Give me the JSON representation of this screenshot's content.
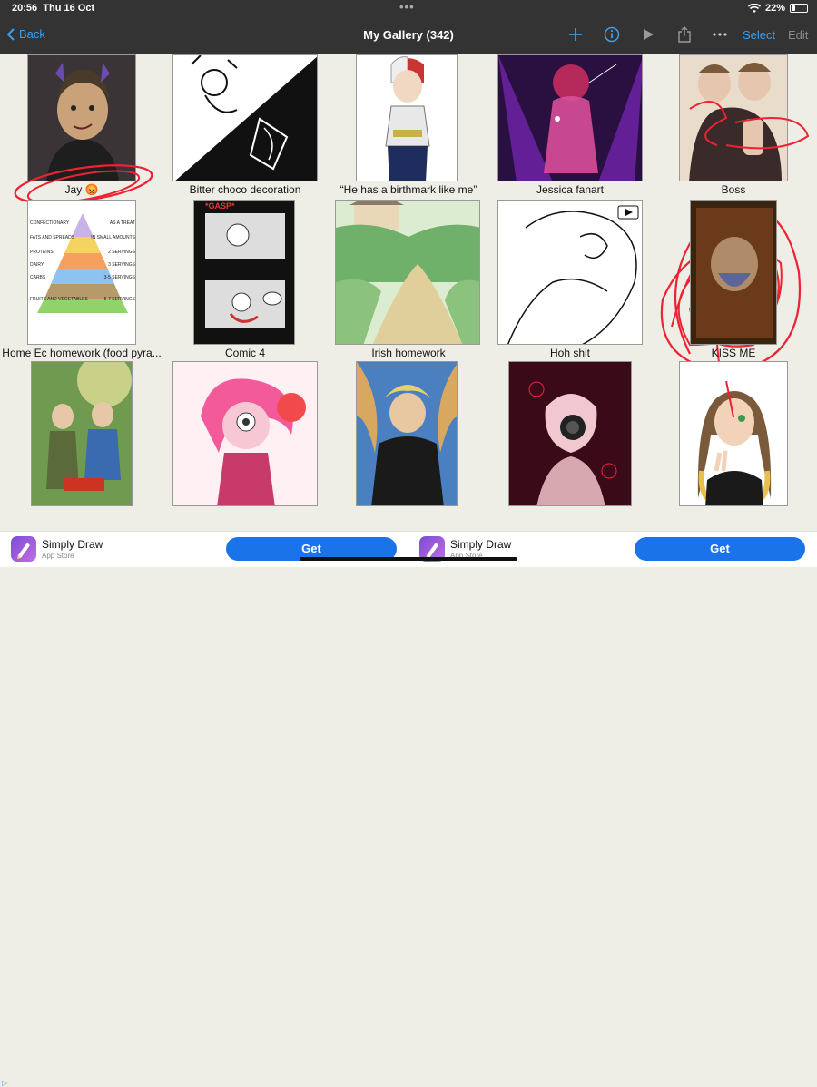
{
  "status": {
    "time": "20:56",
    "date": "Thu 16 Oct",
    "battery": "22%",
    "battery_level": 0.22
  },
  "nav": {
    "back_label": "Back",
    "title": "My Gallery (342)",
    "select_label": "Select",
    "edit_label": "Edit"
  },
  "gallery": {
    "items": [
      {
        "caption": "Jay 😡"
      },
      {
        "caption": "Bitter choco decoration"
      },
      {
        "caption": "“He has a birthmark like me”"
      },
      {
        "caption": "Jessica fanart"
      },
      {
        "caption": "Boss"
      },
      {
        "caption": "Home Ec homework (food pyra..."
      },
      {
        "caption": "Comic 4"
      },
      {
        "caption": "Irish homework"
      },
      {
        "caption": "Hoh shit"
      },
      {
        "caption": "KISS ME"
      }
    ],
    "pyramid_text": {
      "l1": "CONFECTIONARY",
      "l1b": "AS A TREAT",
      "l2": "FATS AND SPREADS",
      "l2b": "IN SMALL AMOUNTS",
      "l3": "PROTEINS",
      "l3b": "2 SERVINGS",
      "l4": "DAIRY",
      "l4b": "3 SERVINGS",
      "l5": "CARBS",
      "l5b": "3-5 SERVINGS",
      "l6": "FRUITS AND VEGETABLES",
      "l6b": "5-7 SERVINGS"
    },
    "comic_text": {
      "title": "*GASP*"
    }
  },
  "ads": [
    {
      "name": "Simply Draw",
      "store": "App Store",
      "cta": "Get"
    },
    {
      "name": "Simply Draw",
      "store": "App Store",
      "cta": "Get"
    }
  ]
}
